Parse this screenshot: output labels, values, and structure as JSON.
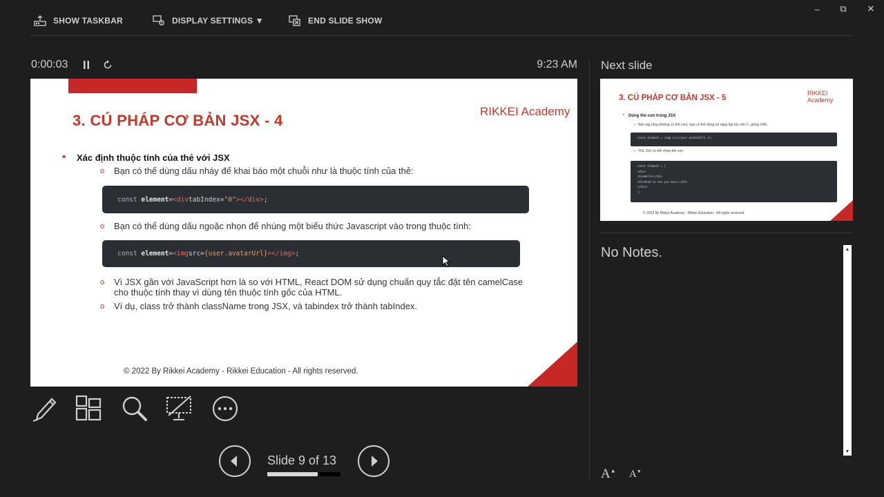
{
  "toolbar": {
    "show_taskbar": "SHOW TASKBAR",
    "display_settings": "DISPLAY SETTINGS ▼",
    "end_slide_show": "END SLIDE SHOW"
  },
  "window_controls": {
    "minimize": "–",
    "restore": "⧉",
    "close": "✕"
  },
  "presenter": {
    "elapsed": "0:00:03",
    "clock": "9:23 AM"
  },
  "slide": {
    "title": "3. CÚ PHÁP CƠ BẢN JSX - 4",
    "logo": "RIKKEI Academy",
    "bullet": "Xác định thuộc tính của thẻ với JSX",
    "sub1": "Bạn có thể dùng dấu nháy để khai báo một chuỗi như là thuộc tính của thẻ:",
    "code1": {
      "kw": "const",
      "var": "element",
      "eq": " = ",
      "tag_open": "<div",
      "attr": " tabIndex=",
      "str": "\"0\"",
      "tag_close": "></div>",
      "end": ";"
    },
    "sub2": "Bạn có thể dùng dấu ngoặc nhọn để nhúng một biểu thức Javascript vào trong thuộc tính:",
    "code2": {
      "kw": "const",
      "var": "element",
      "eq": " = ",
      "tag_open": "<img",
      "attr": " src=",
      "str": "{user.avatarUrl}",
      "tag_close": "></img>",
      "end": ";"
    },
    "sub3": "Vì JSX gần với JavaScript hơn là so với HTML, React DOM sử dụng chuẩn quy tắc đặt tên camelCase cho thuộc tính thay vì dùng tên thuộc tính gốc của HTML.",
    "sub4": "Ví dụ, class trở thành className trong JSX, và tabindex trở thành tabIndex.",
    "footer": "© 2022 By Rikkei Academy - Rikkei Education - All rights reserved."
  },
  "navigation": {
    "slide_label": "Slide 9 of 13",
    "current": 9,
    "total": 13,
    "progress": 0.69
  },
  "next_slide": {
    "label": "Next slide",
    "title": "3. CÚ PHÁP CƠ BẢN JSX - 5",
    "logo": "RIKKEI Academy",
    "bullet": "Dùng thẻ con trong JSX",
    "sub1": "Nếu tag rỗng (không có thẻ con), bạn có thể đóng nó ngay lập tức với />, giống XML:",
    "code1": "const element = <img src={user.avatarUrl} />;",
    "sub2": "Thẻ JSX có thể chứa thẻ con:",
    "code2": [
      "const element = (",
      "  <div>",
      "    <h1>Hello!</h1>",
      "    <h2>Good to see you here.</h2>",
      "  </div>",
      ");"
    ],
    "footer": "© 2022 By Rikkei Academy - Rikkei Education - All rights reserved."
  },
  "notes": {
    "text": "No Notes."
  },
  "font_controls": {
    "increase": "A",
    "decrease": "A"
  },
  "icons": {
    "taskbar": "taskbar-icon",
    "display": "display-settings-icon",
    "end": "end-show-icon",
    "pause": "pause-icon",
    "reset": "reset-timer-icon",
    "pen": "pen-icon",
    "see_all": "see-all-slides-icon",
    "zoom": "zoom-icon",
    "black_screen": "black-screen-icon",
    "more": "more-options-icon",
    "prev": "previous-slide-icon",
    "next": "next-slide-icon"
  },
  "colors": {
    "background": "#1e1e1e",
    "accent": "#c62828",
    "text": "#cfcfcf"
  }
}
